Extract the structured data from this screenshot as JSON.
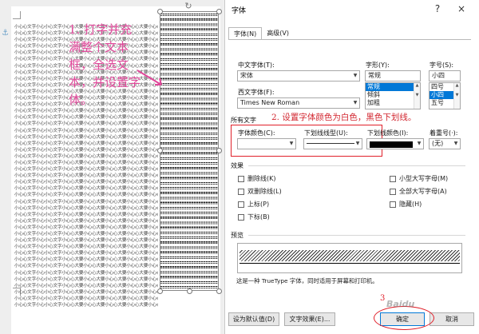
{
  "document": {
    "body_text_line": "小心心文字小心小心文字小心心大要小心心大要小心心大要小心心大要小心心大要",
    "annotation": "1. 打字并充满整个文本框，全选文本，并设置字体。"
  },
  "dialog": {
    "title": "字体",
    "help": "?",
    "close": "×",
    "tabs": [
      "字体(N)",
      "高级(V)"
    ],
    "chinese_font_label": "中文字体(T):",
    "chinese_font_value": "宋体",
    "western_font_label": "西文字体(F):",
    "western_font_value": "Times New Roman",
    "style_label": "字形(Y):",
    "style_value": "常规",
    "style_options": [
      "常规",
      "倾斜",
      "加粗"
    ],
    "size_label": "字号(S):",
    "size_value": "小四",
    "size_options": [
      "四号",
      "小四",
      "五号"
    ],
    "all_text_label": "所有文字",
    "font_color_label": "字体颜色(C):",
    "underline_style_label": "下划线线型(U):",
    "underline_color_label": "下划线颜色(I):",
    "emphasis_label": "着重号(·):",
    "emphasis_value": "(无)",
    "annotation2": "2. 设置字体颜色为白色，黑色下划线。",
    "effects_label": "效果",
    "effects_left": [
      "删除线(K)",
      "双删除线(L)",
      "上标(P)",
      "下标(B)"
    ],
    "effects_right": [
      "小型大写字母(M)",
      "全部大写字母(A)",
      "隐藏(H)"
    ],
    "preview_label": "预览",
    "preview_desc": "这是一种 TrueType 字体，同时适用于屏幕和打印机。",
    "buttons": {
      "default": "设为默认值(D)",
      "text_effects": "文字效果(E)...",
      "ok": "确定",
      "cancel": "取消"
    },
    "step3": "3",
    "watermark": "Baidu"
  },
  "colors": {
    "accent": "#0078d7",
    "annotation_pink": "#e0489a",
    "annotation_red": "#d2262f"
  }
}
